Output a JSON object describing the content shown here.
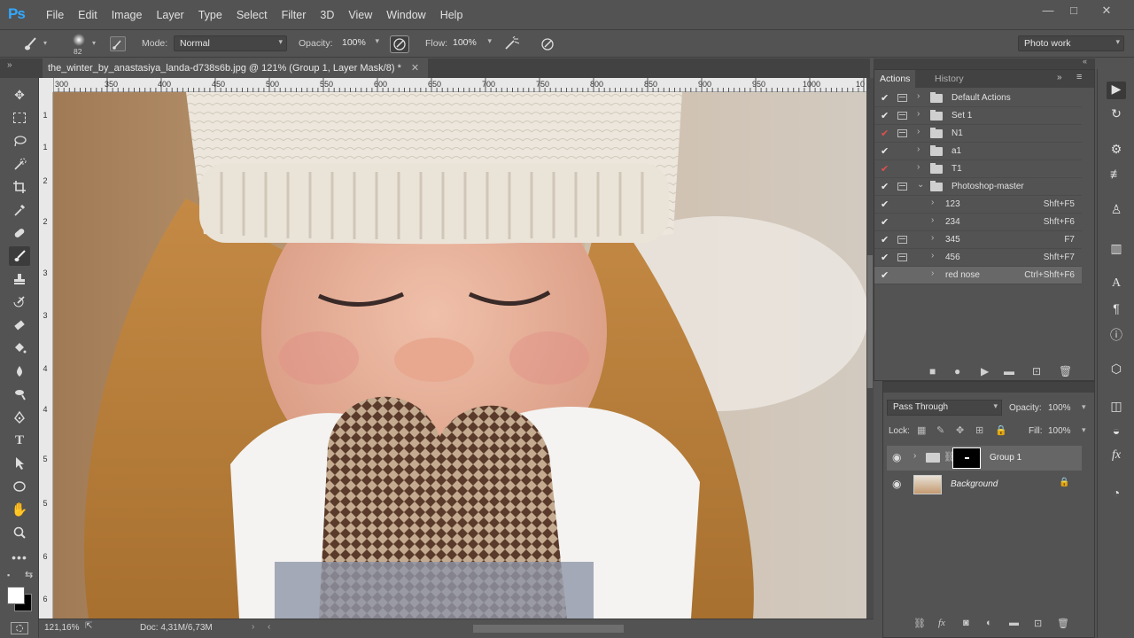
{
  "app": {
    "logo": "Ps"
  },
  "menu": [
    "File",
    "Edit",
    "Image",
    "Layer",
    "Type",
    "Select",
    "Filter",
    "3D",
    "View",
    "Window",
    "Help"
  ],
  "window_controls": {
    "minimize": "—",
    "maximize": "□",
    "close": "✕"
  },
  "options_bar": {
    "brush_size": "82",
    "mode_label": "Mode:",
    "mode_value": "Normal",
    "opacity_label": "Opacity:",
    "opacity_value": "100%",
    "flow_label": "Flow:",
    "flow_value": "100%",
    "workspace": "Photo work"
  },
  "document": {
    "tab_title": "the_winter_by_anastasiya_landa-d738s6b.jpg @ 121% (Group 1, Layer Mask/8) *",
    "close": "✕",
    "ruler_h": [
      "300",
      "350",
      "400",
      "450",
      "500",
      "550",
      "600",
      "650",
      "700",
      "750",
      "800",
      "850",
      "900",
      "950",
      "1000",
      "10"
    ],
    "ruler_v": [
      "1",
      "1",
      "2",
      "2",
      "3",
      "3",
      "4",
      "4",
      "5",
      "5",
      "6",
      "6"
    ]
  },
  "status": {
    "zoom": "121,16%",
    "doc": "Doc: 4,31M/6,73M"
  },
  "actions_panel": {
    "tabs": [
      "Actions",
      "History"
    ],
    "rows": [
      {
        "label": "Default Actions",
        "key": "",
        "check": "✔",
        "red": false,
        "dialog": true,
        "type": "folder",
        "expanded": false
      },
      {
        "label": "Set 1",
        "key": "",
        "check": "✔",
        "red": false,
        "dialog": true,
        "type": "folder",
        "expanded": false
      },
      {
        "label": "N1",
        "key": "",
        "check": "✔",
        "red": true,
        "dialog": true,
        "type": "folder",
        "expanded": false
      },
      {
        "label": "a1",
        "key": "",
        "check": "✔",
        "red": false,
        "dialog": false,
        "type": "folder",
        "expanded": false
      },
      {
        "label": "T1",
        "key": "",
        "check": "✔",
        "red": true,
        "dialog": false,
        "type": "folder",
        "expanded": false
      },
      {
        "label": "Photoshop-master",
        "key": "",
        "check": "✔",
        "red": false,
        "dialog": true,
        "type": "folder",
        "expanded": true
      },
      {
        "label": "123",
        "key": "Shft+F5",
        "check": "✔",
        "red": false,
        "dialog": false,
        "type": "action",
        "expanded": false
      },
      {
        "label": "234",
        "key": "Shft+F6",
        "check": "✔",
        "red": false,
        "dialog": false,
        "type": "action",
        "expanded": false
      },
      {
        "label": "345",
        "key": "F7",
        "check": "✔",
        "red": false,
        "dialog": true,
        "type": "action",
        "expanded": false
      },
      {
        "label": "456",
        "key": "Shft+F7",
        "check": "✔",
        "red": false,
        "dialog": true,
        "type": "action",
        "expanded": false
      },
      {
        "label": "red nose",
        "key": "Ctrl+Shft+F6",
        "check": "✔",
        "red": false,
        "dialog": false,
        "type": "action",
        "expanded": false
      }
    ]
  },
  "layers_panel": {
    "blend_mode": "Pass Through",
    "opacity_label": "Opacity:",
    "opacity_value": "100%",
    "lock_label": "Lock:",
    "fill_label": "Fill:",
    "fill_value": "100%",
    "layers": [
      {
        "name": "Group 1",
        "type": "group",
        "selected": true
      },
      {
        "name": "Background",
        "type": "image",
        "selected": false
      }
    ]
  }
}
